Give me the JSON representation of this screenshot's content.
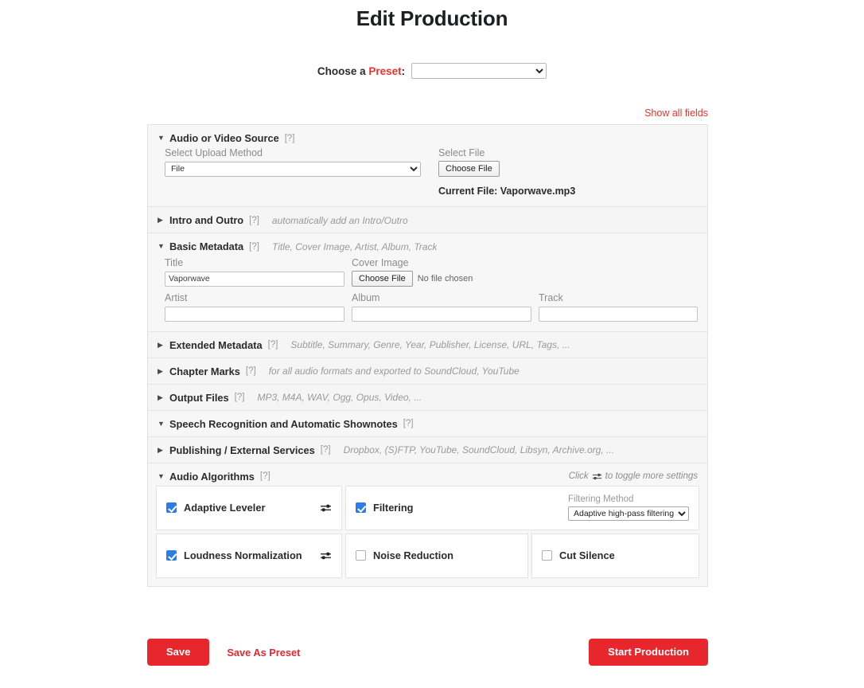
{
  "header": {
    "title": "Edit Production",
    "preset_label_prefix": "Choose a ",
    "preset_label_accent": "Preset",
    "preset_label_suffix": ":",
    "preset_value": "",
    "preset_options": [
      ""
    ]
  },
  "toolbar": {
    "show_all_fields": "Show all fields"
  },
  "help_marker": "[?]",
  "sections": [
    {
      "id": "source",
      "title": "Audio or Video Source",
      "expanded": true,
      "triangle": "▼",
      "hint": "",
      "upload_method_label": "Select Upload Method",
      "upload_method_value": "File",
      "upload_method_options": [
        "File"
      ],
      "select_file_label": "Select File",
      "choose_file_button": "Choose File",
      "current_file": "Current File: Vaporwave.mp3"
    },
    {
      "id": "intro-outro",
      "title": "Intro and Outro",
      "expanded": false,
      "triangle": "▶",
      "hint": "automatically add an Intro/Outro"
    },
    {
      "id": "basic-metadata",
      "title": "Basic Metadata",
      "expanded": true,
      "triangle": "▼",
      "hint": "Title, Cover Image, Artist, Album, Track",
      "fields": {
        "title_label": "Title",
        "title_value": "Vaporwave",
        "cover_label": "Cover Image",
        "cover_button": "Choose File",
        "cover_status": "No file chosen",
        "artist_label": "Artist",
        "artist_value": "",
        "album_label": "Album",
        "album_value": "",
        "track_label": "Track",
        "track_value": ""
      }
    },
    {
      "id": "extended-metadata",
      "title": "Extended Metadata",
      "expanded": false,
      "triangle": "▶",
      "hint": "Subtitle, Summary, Genre, Year, Publisher, License, URL, Tags, ..."
    },
    {
      "id": "chapter-marks",
      "title": "Chapter Marks",
      "expanded": false,
      "triangle": "▶",
      "hint": "for all audio formats and exported to SoundCloud, YouTube"
    },
    {
      "id": "output-files",
      "title": "Output Files",
      "expanded": false,
      "triangle": "▶",
      "hint": "MP3, M4A, WAV, Ogg, Opus, Video, ..."
    },
    {
      "id": "speech-recognition",
      "title": "Speech Recognition and Automatic Shownotes",
      "expanded": true,
      "triangle": "▼",
      "hint": ""
    },
    {
      "id": "publishing",
      "title": "Publishing / External Services",
      "expanded": false,
      "triangle": "▶",
      "hint": "Dropbox, (S)FTP, YouTube, SoundCloud, Libsyn, Archive.org, ..."
    },
    {
      "id": "audio-algorithms",
      "title": "Audio Algorithms",
      "expanded": true,
      "triangle": "▼",
      "hint": "",
      "toggle_hint_before": "Click",
      "toggle_hint_after": "to toggle more settings"
    }
  ],
  "audio_algorithms": {
    "items": [
      {
        "name": "Adaptive Leveler",
        "checked": true,
        "has_sliders": true,
        "extra": null
      },
      {
        "name": "Filtering",
        "checked": true,
        "has_sliders": false,
        "extra": {
          "label": "Filtering Method",
          "value": "Adaptive high-pass filtering",
          "options": [
            "Adaptive high-pass filtering"
          ]
        }
      },
      {
        "name": "Loudness Normalization",
        "checked": true,
        "has_sliders": true,
        "extra": null
      },
      {
        "name": "Noise Reduction",
        "checked": false,
        "has_sliders": false,
        "extra": null
      },
      {
        "name": "Cut Silence",
        "checked": false,
        "has_sliders": false,
        "extra": null
      }
    ]
  },
  "footer": {
    "save": "Save",
    "save_as_preset": "Save As Preset",
    "start_production": "Start Production"
  },
  "colors": {
    "accent_red": "#e8272c",
    "checkbox_blue": "#2b7de9",
    "panel_bg": "#f7f7f7",
    "muted_text": "#9a9a9a"
  }
}
